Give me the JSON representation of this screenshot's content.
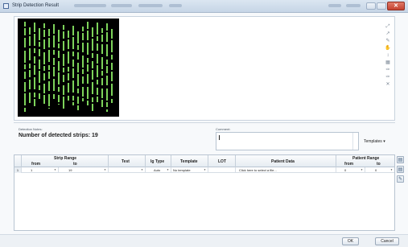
{
  "window": {
    "title": "Strip Detection Result",
    "close_glyph": "✕"
  },
  "detection": {
    "notes_label": "Detection Notes:",
    "count_text": "Number of detected strips: 19",
    "strip_count": 19
  },
  "comment": {
    "label": "Comment:",
    "value": ""
  },
  "templates_label": "Templates",
  "table": {
    "headers": {
      "strip_range": "Strip Range",
      "from": "from",
      "to": "to",
      "test": "Test",
      "ig_type": "Ig Type",
      "template": "Template",
      "lot": "LOT",
      "patient_data": "Patient Data",
      "patient_range": "Patient Range",
      "p_from": "from",
      "p_to": "to"
    },
    "rows": [
      {
        "num": "1",
        "from": "1",
        "to": "19",
        "test": "",
        "ig_type": "Auto",
        "template": "No template",
        "lot": "",
        "patient_data": "Click here to select a file...",
        "p_from": "0",
        "p_to": "0"
      }
    ]
  },
  "buttons": {
    "ok": "OK",
    "cancel": "Cancel"
  },
  "colors": {
    "strip": "#7dd35a",
    "image_bg": "#000000"
  },
  "icons": [
    "zoom-in-icon",
    "zoom-out-icon",
    "rotate-icon",
    "pan-icon",
    "measure-icon",
    "mark-icon",
    "pin-icon",
    "pin-alt-icon",
    "clear-icon"
  ]
}
